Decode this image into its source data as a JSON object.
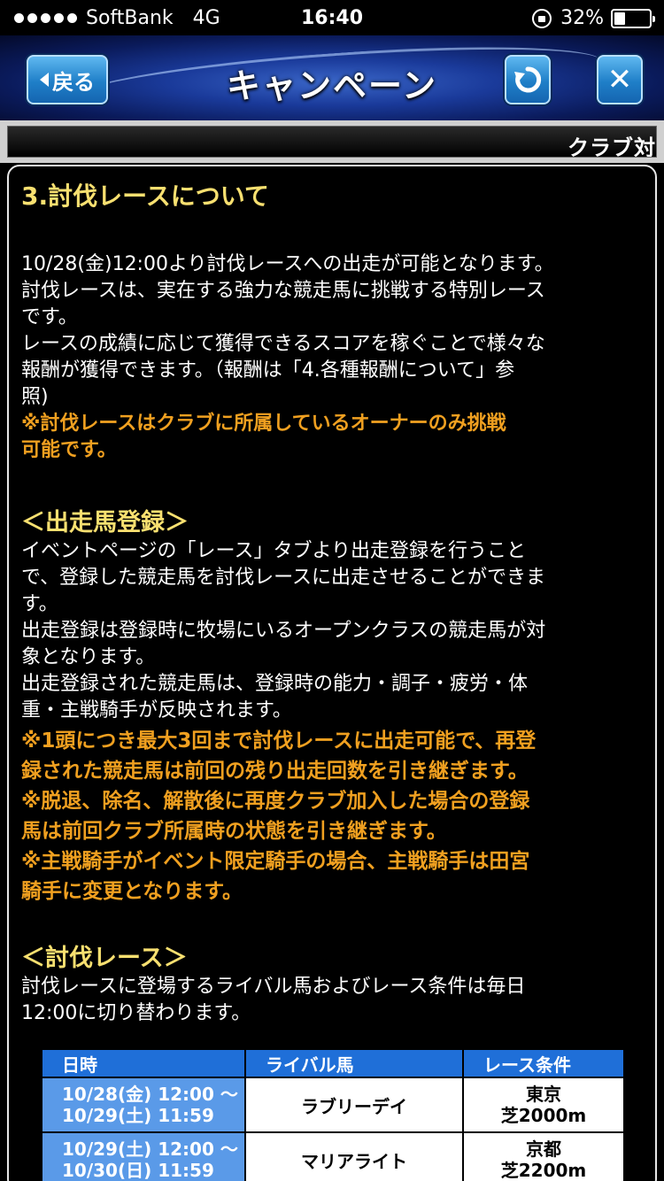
{
  "status": {
    "carrier": "SoftBank",
    "network": "4G",
    "time": "16:40",
    "battery": "32%",
    "battery_level": 0.32
  },
  "nav": {
    "back_label": "戻る",
    "title": "キャンペーン",
    "reload_icon": "reload-icon",
    "close_label": "✕"
  },
  "ticker": {
    "text": "クラブ対"
  },
  "section": {
    "title": "3.討伐レースについて",
    "intro": [
      "10/28(金)12:00より討伐レースへの出走が可能となります。",
      "討伐レースは、実在する強力な競走馬に挑戦する特別レース",
      "です。",
      "レースの成績に応じて獲得できるスコアを稼ぐことで様々な",
      "報酬が獲得できます。（報酬は「4.各種報酬について」参",
      "照)"
    ],
    "intro_note": [
      "※討伐レースはクラブに所属しているオーナーのみ挑戦",
      "可能です。"
    ],
    "entry_heading": "＜出走馬登録＞",
    "entry_text": [
      "イベントページの「レース」タブより出走登録を行うこと",
      "で、登録した競走馬を討伐レースに出走させることができま",
      "す。",
      "出走登録は登録時に牧場にいるオープンクラスの競走馬が対",
      "象となります。",
      "出走登録された競走馬は、登録時の能力・調子・疲労・体",
      "重・主戦騎手が反映されます。"
    ],
    "entry_notes": [
      "※1頭につき最大3回まで討伐レースに出走可能で、再登",
      "録された競走馬は前回の残り出走回数を引き継ぎます。",
      "※脱退、除名、解散後に再度クラブ加入した場合の登録",
      "馬は前回クラブ所属時の状態を引き継ぎます。",
      "※主戦騎手がイベント限定騎手の場合、主戦騎手は田宮",
      "騎手に変更となります。"
    ],
    "race_heading": "＜討伐レース＞",
    "race_text": [
      "討伐レースに登場するライバル馬およびレース条件は毎日",
      "12:00に切り替わります。"
    ]
  },
  "table": {
    "headers": [
      "日時",
      "ライバル馬",
      "レース条件"
    ],
    "rows": [
      {
        "date1": "10/28(金) 12:00 〜",
        "date2": "10/29(土) 11:59",
        "horse": "ラブリーデイ",
        "cond1": "東京",
        "cond2": "芝2000m"
      },
      {
        "date1": "10/29(土) 12:00 〜",
        "date2": "10/30(日) 11:59",
        "horse": "マリアライト",
        "cond1": "京都",
        "cond2": "芝2200m"
      }
    ]
  }
}
